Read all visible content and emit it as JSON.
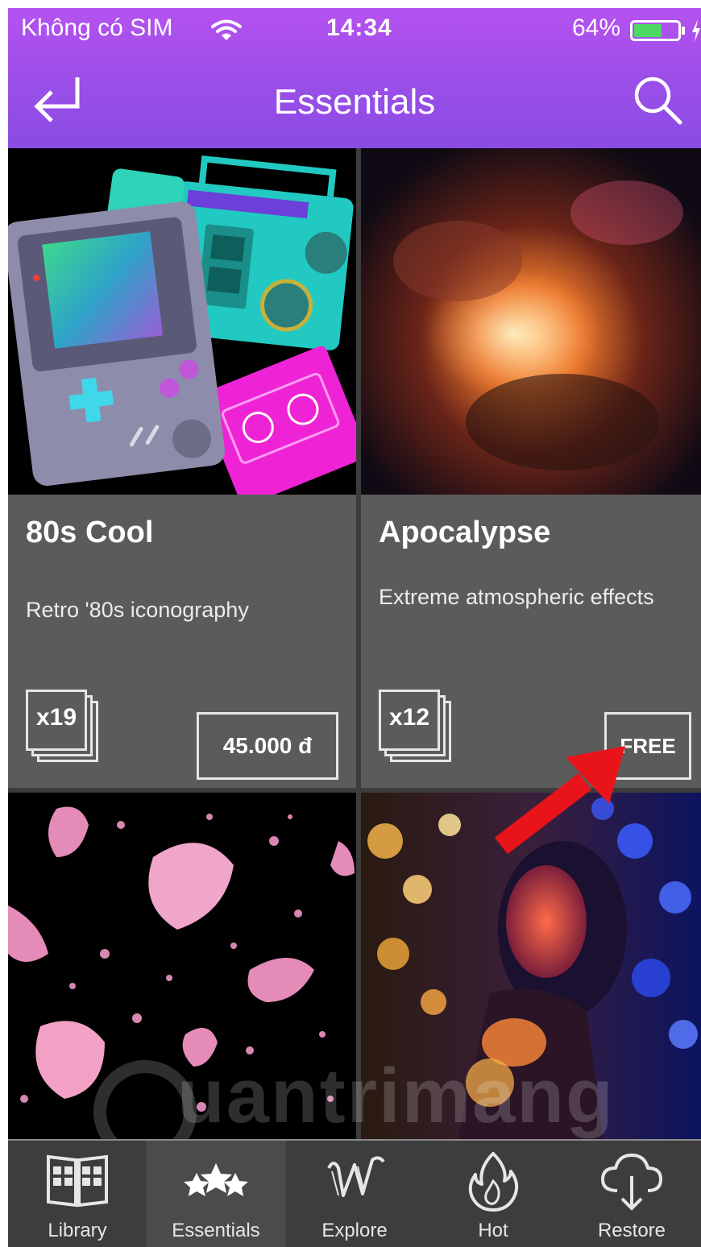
{
  "status_bar": {
    "carrier": "Không có SIM",
    "time": "14:34",
    "battery": "64%",
    "battery_level": 0.64
  },
  "header": {
    "title": "Essentials",
    "back_icon": "back-arrow-icon",
    "search_icon": "search-icon"
  },
  "cards": [
    {
      "title": "80s Cool",
      "description": "Retro '80s iconography",
      "count": "x19",
      "price": "45.000 đ"
    },
    {
      "title": "Apocalypse",
      "description": "Extreme atmospheric effects",
      "count": "x12",
      "price": "FREE"
    }
  ],
  "watermark": "uantrimang",
  "tabs": [
    {
      "label": "Library",
      "icon": "library-icon",
      "active": false
    },
    {
      "label": "Essentials",
      "icon": "stars-icon",
      "active": true
    },
    {
      "label": "Explore",
      "icon": "explore-w-icon",
      "active": false
    },
    {
      "label": "Hot",
      "icon": "flame-icon",
      "active": false
    },
    {
      "label": "Restore",
      "icon": "cloud-download-icon",
      "active": false
    }
  ],
  "colors": {
    "header_top": "#b552f0",
    "header_bottom": "#8a4ce4",
    "card_bg": "#5b5b5b",
    "tabbar_bg": "#3d3d3d",
    "battery_green": "#4cd964",
    "annotation_red": "#e8141a"
  }
}
